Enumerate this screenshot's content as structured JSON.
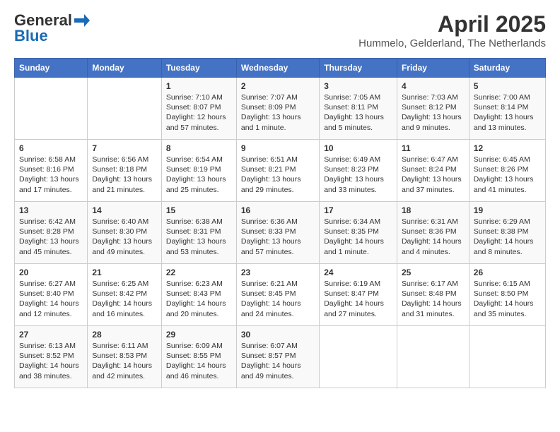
{
  "logo": {
    "general": "General",
    "blue": "Blue"
  },
  "header": {
    "title": "April 2025",
    "subtitle": "Hummelo, Gelderland, The Netherlands"
  },
  "days_of_week": [
    "Sunday",
    "Monday",
    "Tuesday",
    "Wednesday",
    "Thursday",
    "Friday",
    "Saturday"
  ],
  "weeks": [
    [
      {
        "day": "",
        "info": ""
      },
      {
        "day": "",
        "info": ""
      },
      {
        "day": "1",
        "info": "Sunrise: 7:10 AM\nSunset: 8:07 PM\nDaylight: 12 hours and 57 minutes."
      },
      {
        "day": "2",
        "info": "Sunrise: 7:07 AM\nSunset: 8:09 PM\nDaylight: 13 hours and 1 minute."
      },
      {
        "day": "3",
        "info": "Sunrise: 7:05 AM\nSunset: 8:11 PM\nDaylight: 13 hours and 5 minutes."
      },
      {
        "day": "4",
        "info": "Sunrise: 7:03 AM\nSunset: 8:12 PM\nDaylight: 13 hours and 9 minutes."
      },
      {
        "day": "5",
        "info": "Sunrise: 7:00 AM\nSunset: 8:14 PM\nDaylight: 13 hours and 13 minutes."
      }
    ],
    [
      {
        "day": "6",
        "info": "Sunrise: 6:58 AM\nSunset: 8:16 PM\nDaylight: 13 hours and 17 minutes."
      },
      {
        "day": "7",
        "info": "Sunrise: 6:56 AM\nSunset: 8:18 PM\nDaylight: 13 hours and 21 minutes."
      },
      {
        "day": "8",
        "info": "Sunrise: 6:54 AM\nSunset: 8:19 PM\nDaylight: 13 hours and 25 minutes."
      },
      {
        "day": "9",
        "info": "Sunrise: 6:51 AM\nSunset: 8:21 PM\nDaylight: 13 hours and 29 minutes."
      },
      {
        "day": "10",
        "info": "Sunrise: 6:49 AM\nSunset: 8:23 PM\nDaylight: 13 hours and 33 minutes."
      },
      {
        "day": "11",
        "info": "Sunrise: 6:47 AM\nSunset: 8:24 PM\nDaylight: 13 hours and 37 minutes."
      },
      {
        "day": "12",
        "info": "Sunrise: 6:45 AM\nSunset: 8:26 PM\nDaylight: 13 hours and 41 minutes."
      }
    ],
    [
      {
        "day": "13",
        "info": "Sunrise: 6:42 AM\nSunset: 8:28 PM\nDaylight: 13 hours and 45 minutes."
      },
      {
        "day": "14",
        "info": "Sunrise: 6:40 AM\nSunset: 8:30 PM\nDaylight: 13 hours and 49 minutes."
      },
      {
        "day": "15",
        "info": "Sunrise: 6:38 AM\nSunset: 8:31 PM\nDaylight: 13 hours and 53 minutes."
      },
      {
        "day": "16",
        "info": "Sunrise: 6:36 AM\nSunset: 8:33 PM\nDaylight: 13 hours and 57 minutes."
      },
      {
        "day": "17",
        "info": "Sunrise: 6:34 AM\nSunset: 8:35 PM\nDaylight: 14 hours and 1 minute."
      },
      {
        "day": "18",
        "info": "Sunrise: 6:31 AM\nSunset: 8:36 PM\nDaylight: 14 hours and 4 minutes."
      },
      {
        "day": "19",
        "info": "Sunrise: 6:29 AM\nSunset: 8:38 PM\nDaylight: 14 hours and 8 minutes."
      }
    ],
    [
      {
        "day": "20",
        "info": "Sunrise: 6:27 AM\nSunset: 8:40 PM\nDaylight: 14 hours and 12 minutes."
      },
      {
        "day": "21",
        "info": "Sunrise: 6:25 AM\nSunset: 8:42 PM\nDaylight: 14 hours and 16 minutes."
      },
      {
        "day": "22",
        "info": "Sunrise: 6:23 AM\nSunset: 8:43 PM\nDaylight: 14 hours and 20 minutes."
      },
      {
        "day": "23",
        "info": "Sunrise: 6:21 AM\nSunset: 8:45 PM\nDaylight: 14 hours and 24 minutes."
      },
      {
        "day": "24",
        "info": "Sunrise: 6:19 AM\nSunset: 8:47 PM\nDaylight: 14 hours and 27 minutes."
      },
      {
        "day": "25",
        "info": "Sunrise: 6:17 AM\nSunset: 8:48 PM\nDaylight: 14 hours and 31 minutes."
      },
      {
        "day": "26",
        "info": "Sunrise: 6:15 AM\nSunset: 8:50 PM\nDaylight: 14 hours and 35 minutes."
      }
    ],
    [
      {
        "day": "27",
        "info": "Sunrise: 6:13 AM\nSunset: 8:52 PM\nDaylight: 14 hours and 38 minutes."
      },
      {
        "day": "28",
        "info": "Sunrise: 6:11 AM\nSunset: 8:53 PM\nDaylight: 14 hours and 42 minutes."
      },
      {
        "day": "29",
        "info": "Sunrise: 6:09 AM\nSunset: 8:55 PM\nDaylight: 14 hours and 46 minutes."
      },
      {
        "day": "30",
        "info": "Sunrise: 6:07 AM\nSunset: 8:57 PM\nDaylight: 14 hours and 49 minutes."
      },
      {
        "day": "",
        "info": ""
      },
      {
        "day": "",
        "info": ""
      },
      {
        "day": "",
        "info": ""
      }
    ]
  ]
}
